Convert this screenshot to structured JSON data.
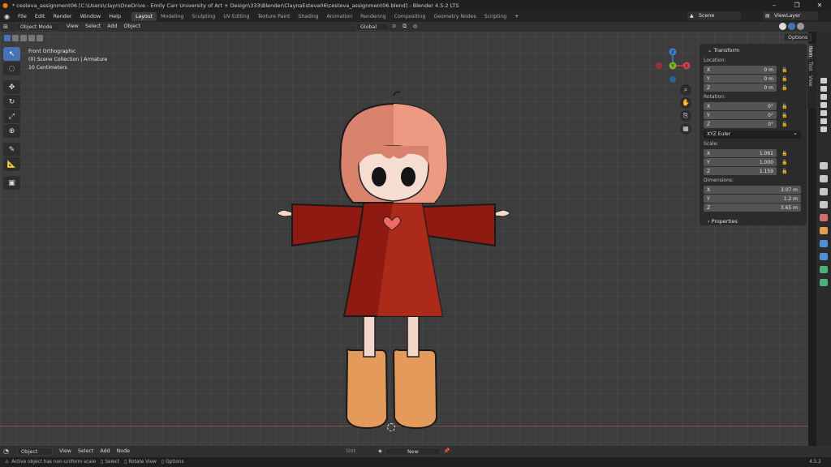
{
  "window": {
    "title": "* cesteva_assignment06 [C:\\Users\\clayn\\OneDrive - Emily Carr University of Art + Design\\333\\Blender\\ClaynaEsteva06\\cesteva_assignment06.blend] - Blender 4.5.2 LTS",
    "controls": [
      "–",
      "❐",
      "✕"
    ]
  },
  "menu": {
    "items": [
      "File",
      "Edit",
      "Render",
      "Window",
      "Help"
    ],
    "workspaces": [
      "Layout",
      "Modeling",
      "Sculpting",
      "UV Editing",
      "Texture Paint",
      "Shading",
      "Animation",
      "Rendering",
      "Compositing",
      "Geometry Nodes",
      "Scripting"
    ],
    "active_workspace": "Layout",
    "add_tab": "+",
    "scene": "Scene",
    "view_layer": "ViewLayer"
  },
  "header": {
    "mode": "Object Mode",
    "menus": [
      "View",
      "Select",
      "Add",
      "Object"
    ],
    "orientation": "Global",
    "options": "Options"
  },
  "viewport": {
    "view_name": "Front Orthographic",
    "collection": "(0) Scene Collection | Armature",
    "scale": "10 Centimeters",
    "gizmo": {
      "z": "Z",
      "y": "Y",
      "x": "X"
    }
  },
  "npanel": {
    "tabs": [
      "Item",
      "Tool",
      "View"
    ],
    "active_tab": "Item",
    "transform_label": "Transform",
    "location_label": "Location:",
    "location": [
      {
        "axis": "X",
        "value": "0 m"
      },
      {
        "axis": "Y",
        "value": "0 m"
      },
      {
        "axis": "Z",
        "value": "0 m"
      }
    ],
    "rotation_label": "Rotation:",
    "rotation": [
      {
        "axis": "X",
        "value": "0°"
      },
      {
        "axis": "Y",
        "value": "0°"
      },
      {
        "axis": "Z",
        "value": "0°"
      }
    ],
    "rotation_mode": "XYZ Euler",
    "scale_label": "Scale:",
    "scale": [
      {
        "axis": "X",
        "value": "1.061"
      },
      {
        "axis": "Y",
        "value": "1.000"
      },
      {
        "axis": "Z",
        "value": "1.159"
      }
    ],
    "dimensions_label": "Dimensions:",
    "dimensions": [
      {
        "axis": "X",
        "value": "3.07 m"
      },
      {
        "axis": "Y",
        "value": "1.2 m"
      },
      {
        "axis": "Z",
        "value": "3.65 m"
      }
    ],
    "properties_label": "Properties"
  },
  "timeline": {
    "mode": "Object",
    "menus": [
      "View",
      "Select",
      "Add",
      "Node"
    ],
    "slot": "Slot",
    "new_button": "New"
  },
  "statusbar": {
    "warning": "Active object has non-uniform scale",
    "hints": [
      "Select",
      "Rotate View",
      "Options"
    ],
    "version": "4.5.2"
  },
  "colors": {
    "accent": "#4772b3",
    "dress": "#8e1a12",
    "hair": "#d9826e",
    "boots": "#e49a5a",
    "skin": "#f3d8cc"
  }
}
